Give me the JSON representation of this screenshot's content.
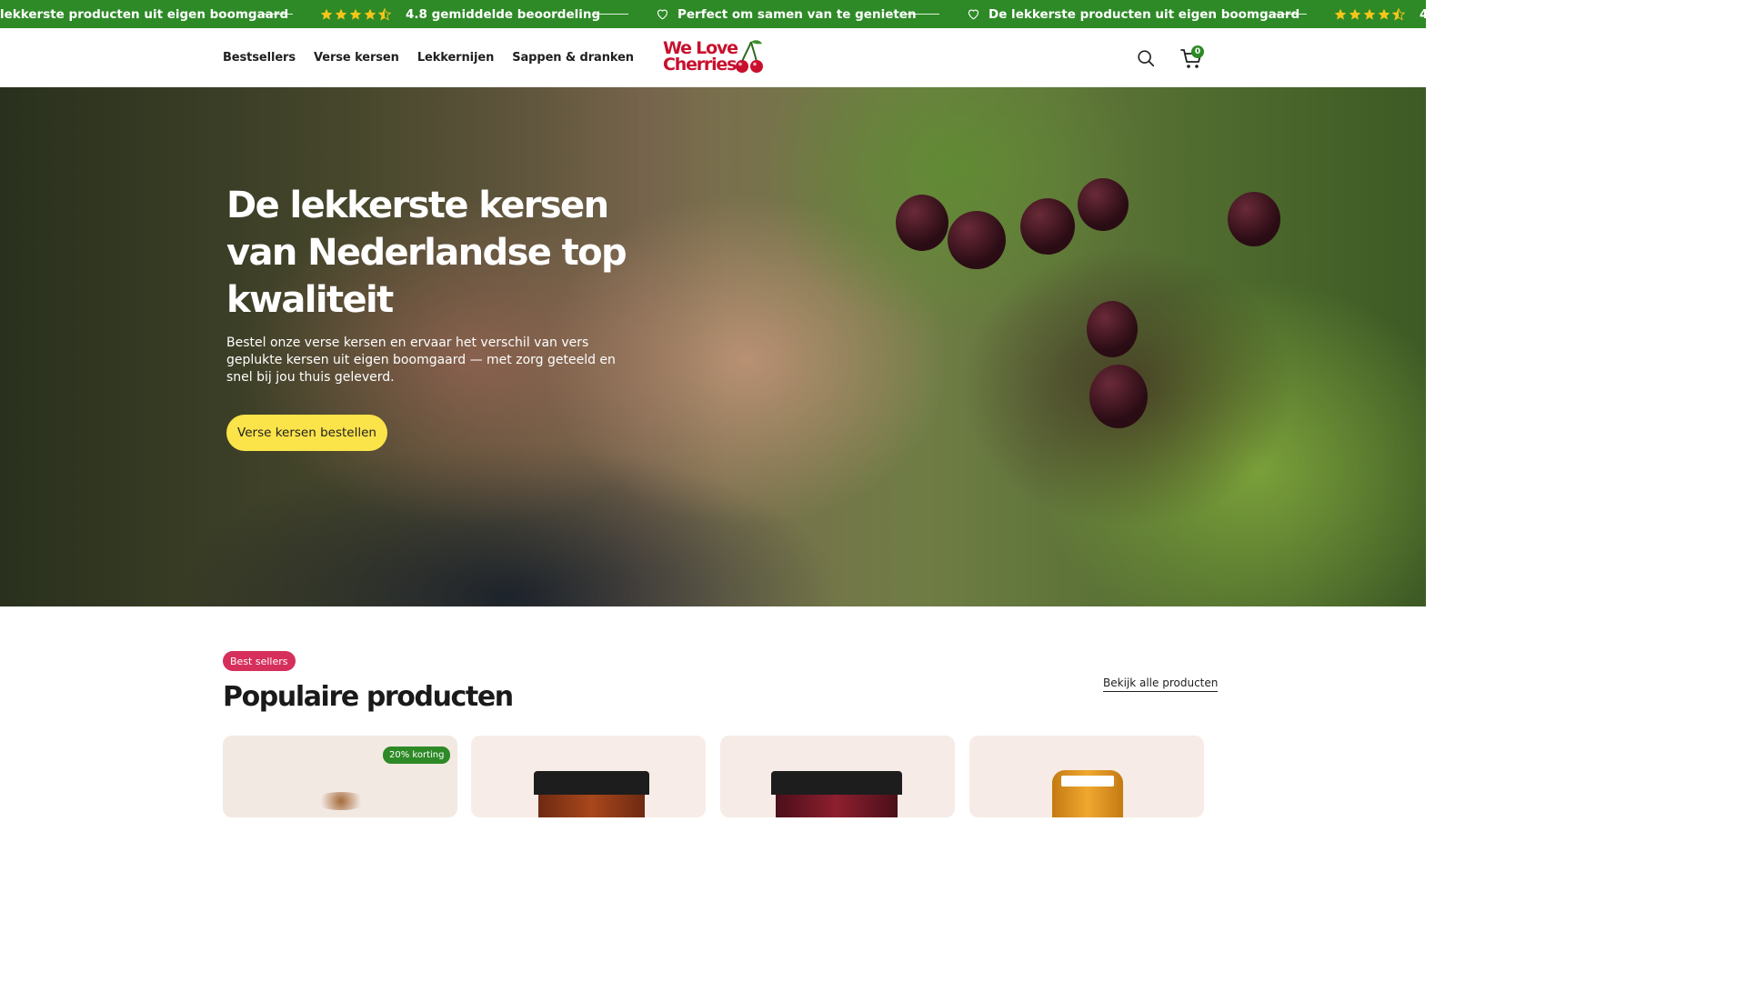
{
  "announcement": {
    "items": [
      {
        "type": "text",
        "text": "lekkerste producten uit eigen boomgaard"
      },
      {
        "type": "rating",
        "text": "4.8 gemiddelde beoordeling",
        "stars": 4.5
      },
      {
        "type": "heart",
        "text": "Perfect om samen van te genieten"
      },
      {
        "type": "heart",
        "text": "De lekkerste producten uit eigen boomgaard"
      },
      {
        "type": "rating",
        "text": "4",
        "stars": 4.5
      }
    ]
  },
  "nav": {
    "items": [
      "Bestsellers",
      "Verse kersen",
      "Lekkernijen",
      "Sappen & dranken"
    ]
  },
  "logo": {
    "line1": "We Love",
    "line2": "Cherries",
    "color": "#c8102e"
  },
  "header": {
    "search_icon": "search-icon",
    "cart_icon": "cart-icon",
    "cart_count": "0"
  },
  "hero": {
    "title": "De lekkerste kersen van Nederlandse top kwaliteit",
    "text": "Bestel onze verse kersen en ervaar het verschil van vers geplukte kersen uit eigen boomgaard — met zorg geteeld en snel bij jou thuis geleverd.",
    "cta": "Verse kersen bestellen"
  },
  "products": {
    "badge": "Best sellers",
    "title": "Populaire producten",
    "view_all": "Bekijk alle producten",
    "cards": [
      {
        "discount": "20% korting"
      }
    ]
  },
  "colors": {
    "green": "#2e8a27",
    "yellow": "#fbe34a",
    "pink": "#d62f5c",
    "star": "#f5c518",
    "red": "#c8102e"
  }
}
